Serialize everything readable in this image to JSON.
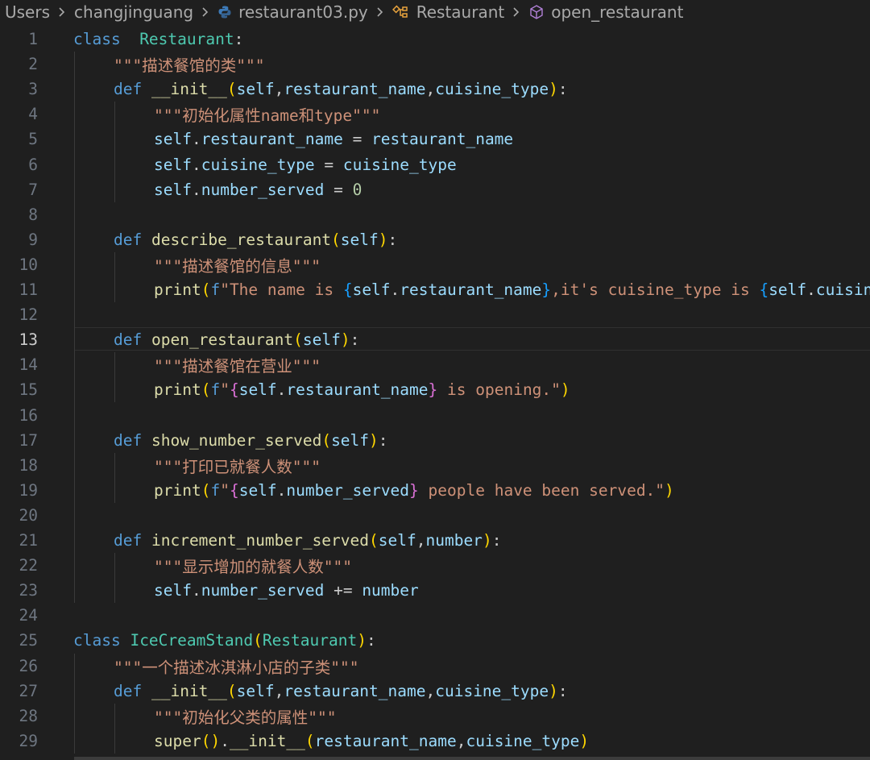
{
  "breadcrumb": {
    "items": [
      {
        "label": "Users",
        "icon": ""
      },
      {
        "label": "changjinguang",
        "icon": ""
      },
      {
        "label": "restaurant03.py",
        "icon": "python-icon"
      },
      {
        "label": "Restaurant",
        "icon": "class-symbol-icon"
      },
      {
        "label": "open_restaurant",
        "icon": "method-symbol-icon"
      }
    ]
  },
  "editor": {
    "current_line": 13,
    "lines": [
      {
        "n": 1,
        "indent": 0,
        "tokens": [
          [
            "kw",
            "class"
          ],
          [
            "",
            "  "
          ],
          [
            "cls",
            "Restaurant"
          ],
          [
            "",
            ":"
          ]
        ]
      },
      {
        "n": 2,
        "indent": 1,
        "tokens": [
          [
            "str",
            "\"\"\"描述餐馆的类\"\"\""
          ]
        ]
      },
      {
        "n": 3,
        "indent": 1,
        "tokens": [
          [
            "kw",
            "def"
          ],
          [
            "",
            " "
          ],
          [
            "fn",
            "__init__"
          ],
          [
            "b1",
            "("
          ],
          [
            "sf",
            "self"
          ],
          [
            "",
            ","
          ],
          [
            "sf",
            "restaurant_name"
          ],
          [
            "",
            ","
          ],
          [
            "sf",
            "cuisine_type"
          ],
          [
            "b1",
            ")"
          ],
          [
            "",
            ":"
          ]
        ]
      },
      {
        "n": 4,
        "indent": 2,
        "tokens": [
          [
            "str",
            "\"\"\"初始化属性name和type\"\"\""
          ]
        ]
      },
      {
        "n": 5,
        "indent": 2,
        "tokens": [
          [
            "sf",
            "self"
          ],
          [
            "",
            "."
          ],
          [
            "sf",
            "restaurant_name"
          ],
          [
            "",
            " = "
          ],
          [
            "sf",
            "restaurant_name"
          ]
        ]
      },
      {
        "n": 6,
        "indent": 2,
        "tokens": [
          [
            "sf",
            "self"
          ],
          [
            "",
            "."
          ],
          [
            "sf",
            "cuisine_type"
          ],
          [
            "",
            " = "
          ],
          [
            "sf",
            "cuisine_type"
          ]
        ]
      },
      {
        "n": 7,
        "indent": 2,
        "tokens": [
          [
            "sf",
            "self"
          ],
          [
            "",
            "."
          ],
          [
            "sf",
            "number_served"
          ],
          [
            "",
            " = "
          ],
          [
            "num",
            "0"
          ]
        ]
      },
      {
        "n": 8,
        "indent": 0,
        "tokens": []
      },
      {
        "n": 9,
        "indent": 1,
        "tokens": [
          [
            "kw",
            "def"
          ],
          [
            "",
            " "
          ],
          [
            "fn",
            "describe_restaurant"
          ],
          [
            "b1",
            "("
          ],
          [
            "sf",
            "self"
          ],
          [
            "b1",
            ")"
          ],
          [
            "",
            ":"
          ]
        ]
      },
      {
        "n": 10,
        "indent": 2,
        "tokens": [
          [
            "str",
            "\"\"\"描述餐馆的信息\"\"\""
          ]
        ]
      },
      {
        "n": 11,
        "indent": 2,
        "tokens": [
          [
            "fn",
            "print"
          ],
          [
            "b1",
            "("
          ],
          [
            "fp",
            "f"
          ],
          [
            "str",
            "\"The name is "
          ],
          [
            "b3",
            "{"
          ],
          [
            "sf",
            "self"
          ],
          [
            "",
            "."
          ],
          [
            "sf",
            "restaurant_name"
          ],
          [
            "b3",
            "}"
          ],
          [
            "str",
            ",it's cuisine_type is "
          ],
          [
            "b3",
            "{"
          ],
          [
            "sf",
            "self"
          ],
          [
            "",
            "."
          ],
          [
            "sf",
            "cuisine_type"
          ],
          [
            "b3",
            "}"
          ],
          [
            "str",
            "\""
          ],
          [
            "b1",
            ")"
          ]
        ]
      },
      {
        "n": 12,
        "indent": 0,
        "tokens": []
      },
      {
        "n": 13,
        "indent": 1,
        "tokens": [
          [
            "kw",
            "def"
          ],
          [
            "",
            " "
          ],
          [
            "fn",
            "open_restaurant"
          ],
          [
            "b1",
            "("
          ],
          [
            "sf",
            "self"
          ],
          [
            "b1",
            ")"
          ],
          [
            "",
            ":"
          ]
        ]
      },
      {
        "n": 14,
        "indent": 2,
        "tokens": [
          [
            "str",
            "\"\"\"描述餐馆在营业\"\"\""
          ]
        ]
      },
      {
        "n": 15,
        "indent": 2,
        "tokens": [
          [
            "fn",
            "print"
          ],
          [
            "b1",
            "("
          ],
          [
            "fp",
            "f"
          ],
          [
            "str",
            "\""
          ],
          [
            "b2",
            "{"
          ],
          [
            "sf",
            "self"
          ],
          [
            "",
            "."
          ],
          [
            "sf",
            "restaurant_name"
          ],
          [
            "b2",
            "}"
          ],
          [
            "str",
            " is opening.\""
          ],
          [
            "b1",
            ")"
          ]
        ]
      },
      {
        "n": 16,
        "indent": 0,
        "tokens": []
      },
      {
        "n": 17,
        "indent": 1,
        "tokens": [
          [
            "kw",
            "def"
          ],
          [
            "",
            " "
          ],
          [
            "fn",
            "show_number_served"
          ],
          [
            "b1",
            "("
          ],
          [
            "sf",
            "self"
          ],
          [
            "b1",
            ")"
          ],
          [
            "",
            ":"
          ]
        ]
      },
      {
        "n": 18,
        "indent": 2,
        "tokens": [
          [
            "str",
            "\"\"\"打印已就餐人数\"\"\""
          ]
        ]
      },
      {
        "n": 19,
        "indent": 2,
        "tokens": [
          [
            "fn",
            "print"
          ],
          [
            "b1",
            "("
          ],
          [
            "fp",
            "f"
          ],
          [
            "str",
            "\""
          ],
          [
            "b2",
            "{"
          ],
          [
            "sf",
            "self"
          ],
          [
            "",
            "."
          ],
          [
            "sf",
            "number_served"
          ],
          [
            "b2",
            "}"
          ],
          [
            "str",
            " people have been served.\""
          ],
          [
            "b1",
            ")"
          ]
        ]
      },
      {
        "n": 20,
        "indent": 0,
        "tokens": []
      },
      {
        "n": 21,
        "indent": 1,
        "tokens": [
          [
            "kw",
            "def"
          ],
          [
            "",
            " "
          ],
          [
            "fn",
            "increment_number_served"
          ],
          [
            "b1",
            "("
          ],
          [
            "sf",
            "self"
          ],
          [
            "",
            ","
          ],
          [
            "sf",
            "number"
          ],
          [
            "b1",
            ")"
          ],
          [
            "",
            ":"
          ]
        ]
      },
      {
        "n": 22,
        "indent": 2,
        "tokens": [
          [
            "str",
            "\"\"\"显示增加的就餐人数\"\"\""
          ]
        ]
      },
      {
        "n": 23,
        "indent": 2,
        "tokens": [
          [
            "sf",
            "self"
          ],
          [
            "",
            "."
          ],
          [
            "sf",
            "number_served"
          ],
          [
            "",
            " += "
          ],
          [
            "sf",
            "number"
          ]
        ]
      },
      {
        "n": 24,
        "indent": 0,
        "tokens": []
      },
      {
        "n": 25,
        "indent": 0,
        "tokens": [
          [
            "kw",
            "class"
          ],
          [
            "",
            " "
          ],
          [
            "cls",
            "IceCreamStand"
          ],
          [
            "b1",
            "("
          ],
          [
            "cls",
            "Restaurant"
          ],
          [
            "b1",
            ")"
          ],
          [
            "",
            ":"
          ]
        ]
      },
      {
        "n": 26,
        "indent": 1,
        "tokens": [
          [
            "str",
            "\"\"\"一个描述冰淇淋小店的子类\"\"\""
          ]
        ]
      },
      {
        "n": 27,
        "indent": 1,
        "tokens": [
          [
            "kw",
            "def"
          ],
          [
            "",
            " "
          ],
          [
            "fn",
            "__init__"
          ],
          [
            "b1",
            "("
          ],
          [
            "sf",
            "self"
          ],
          [
            "",
            ","
          ],
          [
            "sf",
            "restaurant_name"
          ],
          [
            "",
            ","
          ],
          [
            "sf",
            "cuisine_type"
          ],
          [
            "b1",
            ")"
          ],
          [
            "",
            ":"
          ]
        ]
      },
      {
        "n": 28,
        "indent": 2,
        "tokens": [
          [
            "str",
            "\"\"\"初始化父类的属性\"\"\""
          ]
        ]
      },
      {
        "n": 29,
        "indent": 2,
        "tokens": [
          [
            "fn",
            "super"
          ],
          [
            "b1",
            "()"
          ],
          [
            "",
            "."
          ],
          [
            "fn",
            "__init__"
          ],
          [
            "b1",
            "("
          ],
          [
            "sf",
            "restaurant_name"
          ],
          [
            "",
            ","
          ],
          [
            "sf",
            "cuisine_type"
          ],
          [
            "b1",
            ")"
          ]
        ]
      }
    ]
  }
}
